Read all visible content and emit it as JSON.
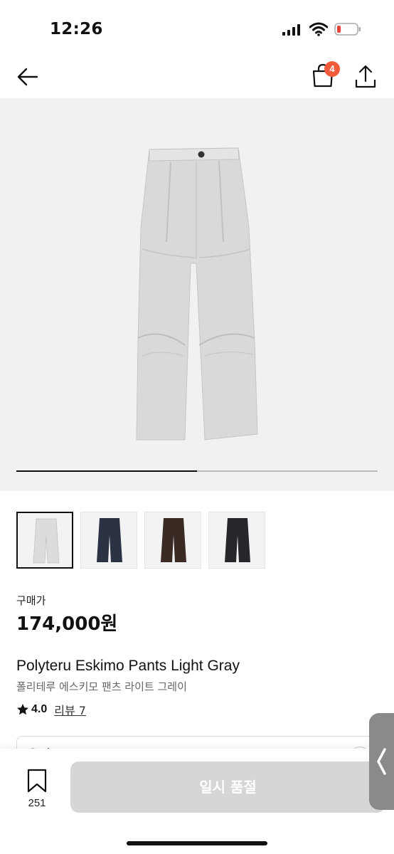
{
  "status_bar": {
    "time": "12:26"
  },
  "header": {
    "cart_count": "4"
  },
  "gallery": {
    "progress": 0.5,
    "thumbnail_colors": [
      "#dcdcdc",
      "#2b3244",
      "#3a2a24",
      "#25272b"
    ]
  },
  "product": {
    "price_label": "구매가",
    "price": "174,000원",
    "name_en": "Polyteru Eskimo Pants Light Gray",
    "name_ko": "폴리테루 에스키모 팬츠 라이트 그레이",
    "rating": "4.0",
    "review_label": "리뷰 7"
  },
  "option": {
    "label": "옵션"
  },
  "bottom_bar": {
    "bookmark_count": "251",
    "soldout_label": "일시 품절"
  },
  "icons": [
    "back-arrow-icon",
    "shopping-bag-icon",
    "share-icon",
    "star-icon",
    "bookmark-icon",
    "chevron-left-icon",
    "signal-icon",
    "wifi-icon",
    "battery-icon"
  ]
}
